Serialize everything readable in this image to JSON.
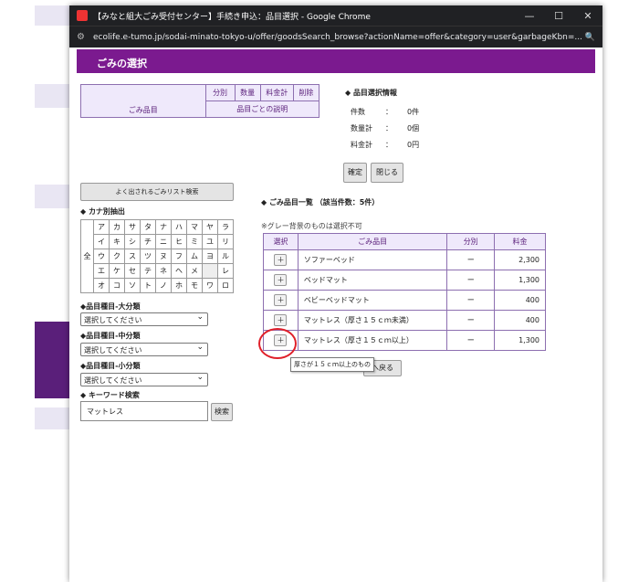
{
  "window": {
    "title": "【みなと組大ごみ受付センター】手続き申込：品目選択 - Google Chrome",
    "url": "ecolife.e-tumo.jp/sodai-minato-tokyo-u/offer/goodsSearch_browse?actionName=offer&category=user&garbageKbn=..."
  },
  "header": {
    "title": "ごみの選択"
  },
  "selection_table": {
    "col_bunbetsu": "分別",
    "col_suryo": "数量",
    "col_ryokin": "料金計",
    "col_sakujo": "削除",
    "col_gomi": "ごみ品目",
    "col_desc": "品目ごとの説明"
  },
  "info": {
    "title": "◆ 品目選択情報",
    "rows": [
      {
        "label": "件数",
        "sep": "：",
        "value": "0件"
      },
      {
        "label": "数量計",
        "sep": "：",
        "value": "0個"
      },
      {
        "label": "料金計",
        "sep": "：",
        "value": "0円"
      }
    ],
    "confirm": "確定",
    "close": "閉じる"
  },
  "left": {
    "frequent_btn": "よく出されるごみリスト検索",
    "kana_title": "◆ カナ別抽出",
    "kana_all": "全",
    "kana_rows": [
      [
        "ア",
        "カ",
        "サ",
        "タ",
        "ナ",
        "ハ",
        "マ",
        "ヤ",
        "ラ"
      ],
      [
        "イ",
        "キ",
        "シ",
        "チ",
        "ニ",
        "ヒ",
        "ミ",
        "ユ",
        "リ"
      ],
      [
        "ウ",
        "ク",
        "ス",
        "ツ",
        "ヌ",
        "フ",
        "ム",
        "ヨ",
        "ル"
      ],
      [
        "エ",
        "ケ",
        "セ",
        "テ",
        "ネ",
        "ヘ",
        "メ",
        "",
        "レ"
      ],
      [
        "オ",
        "コ",
        "ソ",
        "ト",
        "ノ",
        "ホ",
        "モ",
        "ワ",
        "ロ"
      ]
    ],
    "cat_large": "◆品目種目-大分類",
    "cat_mid": "◆品目種目-中分類",
    "cat_small": "◆品目種目-小分類",
    "select_placeholder": "選択してください",
    "keyword_title": "◆ キーワード検索",
    "keyword_value": "マットレス",
    "search_btn": "検索"
  },
  "list": {
    "title": "◆ ごみ品目一覧 （該当件数：5件）",
    "note": "※グレー背景のものは選択不可",
    "headers": [
      "選択",
      "ごみ品目",
      "分別",
      "料金"
    ],
    "rows": [
      {
        "sel": "＋",
        "name": "ソファーベッド",
        "kind": "ー",
        "price": "2,300"
      },
      {
        "sel": "＋",
        "name": "ベッドマット",
        "kind": "ー",
        "price": "1,300"
      },
      {
        "sel": "＋",
        "name": "ベビーベッドマット",
        "kind": "ー",
        "price": "400"
      },
      {
        "sel": "＋",
        "name": "マットレス（厚さ１５ｃｍ未満）",
        "kind": "ー",
        "price": "400"
      },
      {
        "sel": "＋",
        "name": "マットレス（厚さ１５ｃｍ以上）",
        "kind": "ー",
        "price": "1,300"
      }
    ],
    "back_btn": "へ戻る",
    "tooltip": "厚さが１５ｃｍ以上のもの"
  }
}
